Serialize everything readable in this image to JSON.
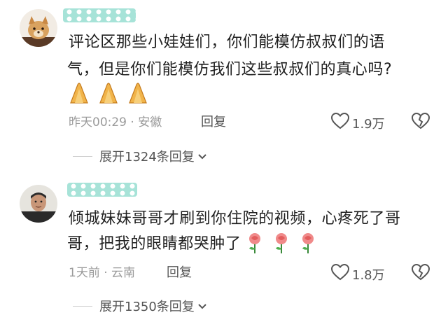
{
  "comments": [
    {
      "text_line1": "评论区那些小娃娃们，你们能模仿叔叔们的语",
      "text_line2": "气，但是你们能模仿我们这些叔叔们的真心吗?",
      "emoji": "hands-icon",
      "time_location": "昨天00:29 · 安徽",
      "reply_label": "回复",
      "likes": "1.9万",
      "expand_label": "展开1324条回复"
    },
    {
      "text_line1": "倾城妹妹哥哥才刷到你住院的视频，心疼死了哥",
      "text_line2": "哥，把我的眼睛都哭肿了",
      "emoji": "rose-icon",
      "time_location": "1天前 · 云南",
      "reply_label": "回复",
      "likes": "1.8万",
      "expand_label": "展开1350条回复"
    }
  ],
  "colors": {
    "namebar": "#a7e3d8",
    "meta": "#9a9a9a",
    "text": "#1f1f1f"
  }
}
